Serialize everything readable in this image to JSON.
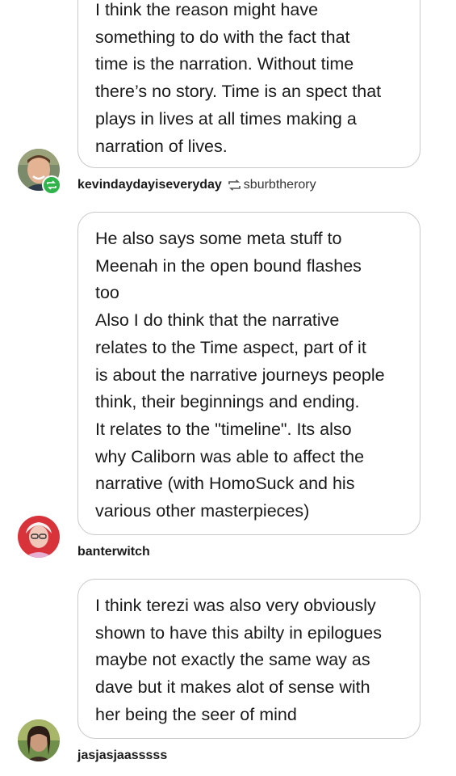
{
  "posts": [
    {
      "text": "I think the reason might have\nsomething to do with the fact that\ntime is the narration. Without time\nthere’s no story. Time is an spect that\nplays in lives at all times making a\nnarration of lives.",
      "username": "kevindaydayiseveryday",
      "reblogged_from": "sburbtherory",
      "avatar_icon": "avatar-photo-icon",
      "badge_icon": "reblog-badge-icon",
      "badge_color": "#2fb34a"
    },
    {
      "text": "He also says some meta stuff to\nMeenah in the open bound flashes\ntoo\nAlso I do think that the narrative\nrelates to the Time aspect, part of it\nis about the narrative journeys people\nthink, their beginnings and ending.\nIt relates to the \"timeline\". Its also\nwhy Caliborn was able to affect the\nnarrative (with HomoSuck and his\nvarious other masterpieces)",
      "username": "banterwitch",
      "avatar_icon": "avatar-photo-icon"
    },
    {
      "text": "I think terezi was also very obviously\nshown to have this abilty in epilogues\nmaybe not exactly the same way as\ndave but it makes alot of sense with\nher being the seer of mind",
      "username": "jasjasjaasssss",
      "avatar_icon": "avatar-photo-icon"
    }
  ]
}
